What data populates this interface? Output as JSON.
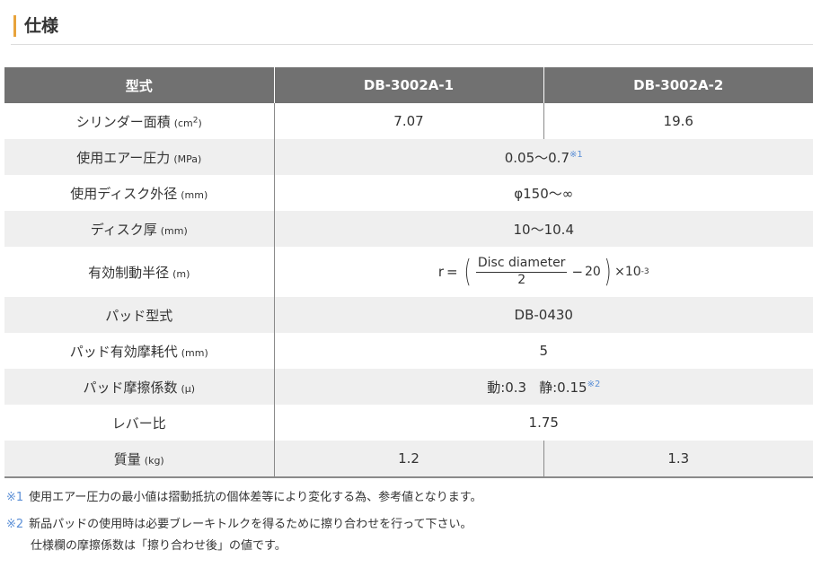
{
  "section": {
    "title": "仕様"
  },
  "table": {
    "headers": [
      "型式",
      "DB-3002A-1",
      "DB-3002A-2"
    ],
    "rows": {
      "cylinder": {
        "label": "シリンダー面積",
        "unit": "(cm",
        "unit_sup": "2",
        "unit_close": ")",
        "v1": "7.07",
        "v2": "19.6"
      },
      "pressure": {
        "label": "使用エアー圧力",
        "unit": "(MPa)",
        "value": "0.05〜0.7",
        "mark": "※1"
      },
      "disc_dia": {
        "label": "使用ディスク外径",
        "unit": "(mm)",
        "value": "φ150〜∞"
      },
      "disc_thick": {
        "label": "ディスク厚",
        "unit": "(mm)",
        "value": "10〜10.4"
      },
      "radius": {
        "label": "有効制動半径",
        "unit": "(m)",
        "r": "r",
        "eq": "=",
        "paren_open": "(",
        "numerator": "Disc diameter",
        "denominator": "2",
        "minus": "−",
        "sub": "20",
        "paren_close": ")",
        "times": "×10",
        "exp": "-3"
      },
      "pad_model": {
        "label": "パッド型式",
        "value": "DB-0430"
      },
      "pad_wear": {
        "label": "パッド有効摩耗代",
        "unit": "(mm)",
        "value": "5"
      },
      "pad_friction": {
        "label": "パッド摩擦係数",
        "unit": "(μ)",
        "dynamic": "動:0.3",
        "static": "静:0.15",
        "mark": "※2"
      },
      "lever": {
        "label": "レバー比",
        "value": "1.75"
      },
      "mass": {
        "label": "質量",
        "unit": "(kg)",
        "v1": "1.2",
        "v2": "1.3"
      }
    }
  },
  "notes": [
    {
      "mark": "※1",
      "text": "使用エアー圧力の最小値は摺動抵抗の個体差等により変化する為、参考値となります。"
    },
    {
      "mark": "※2",
      "text": "新品パッドの使用時は必要ブレーキトルクを得るために擦り合わせを行って下さい。",
      "cont": "仕様欄の摩擦係数は「擦り合わせ後」の値です。"
    }
  ],
  "colors": {
    "accent": "#e8a33c",
    "header_bg": "#717171",
    "alt_row": "#efefef",
    "note_mark": "#5b8fd6"
  }
}
